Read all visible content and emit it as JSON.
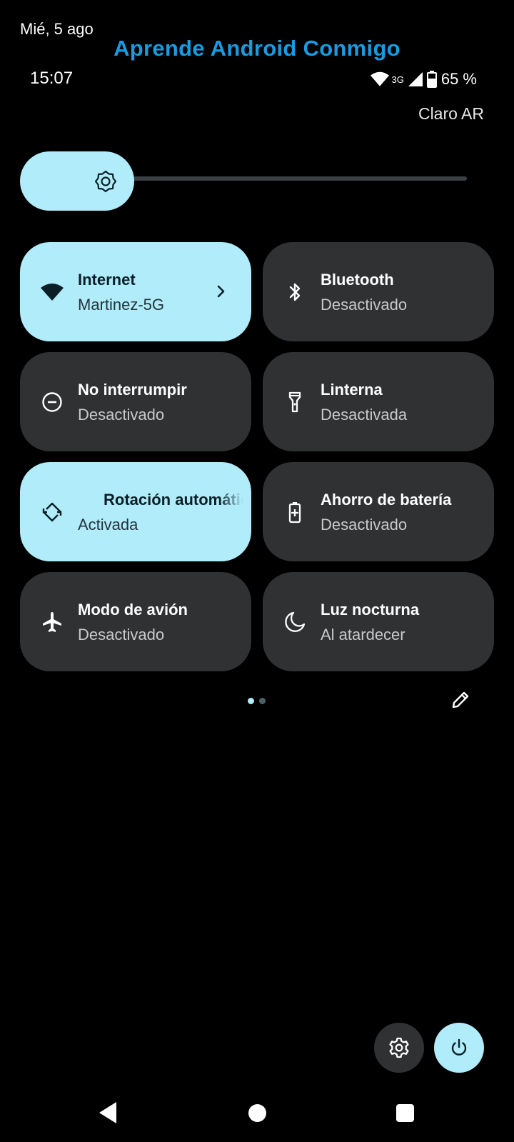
{
  "header": {
    "date": "Mié, 5 ago",
    "watermark": "Aprende Android Conmigo",
    "clock": "15:07",
    "network_type": "3G",
    "battery": "65 %",
    "carrier": "Claro AR"
  },
  "brightness": {
    "level": 0.25
  },
  "tiles": [
    {
      "title": "Internet",
      "subtitle": "Martinez-5G",
      "state": "on",
      "icon": "wifi-icon"
    },
    {
      "title": "Bluetooth",
      "subtitle": "Desactivado",
      "state": "off",
      "icon": "bluetooth-icon"
    },
    {
      "title": "No interrumpir",
      "subtitle": "Desactivado",
      "state": "off",
      "icon": "do-not-disturb-icon"
    },
    {
      "title": "Linterna",
      "subtitle": "Desactivada",
      "state": "off",
      "icon": "flashlight-icon"
    },
    {
      "title": "Rotación automática",
      "subtitle": "Activada",
      "state": "on",
      "icon": "auto-rotate-icon"
    },
    {
      "title": "Ahorro de batería",
      "subtitle": "Desactivado",
      "state": "off",
      "icon": "battery-saver-icon"
    },
    {
      "title": "Modo de avión",
      "subtitle": "Desactivado",
      "state": "off",
      "icon": "airplane-icon"
    },
    {
      "title": "Luz nocturna",
      "subtitle": "Al atardecer",
      "state": "off",
      "icon": "night-light-icon"
    }
  ],
  "pager": {
    "pages": 2,
    "current": 1
  },
  "colors": {
    "accent": "#b1ecfb",
    "tile_off": "#2f3133",
    "watermark": "#1a9be0",
    "background": "#000000"
  }
}
